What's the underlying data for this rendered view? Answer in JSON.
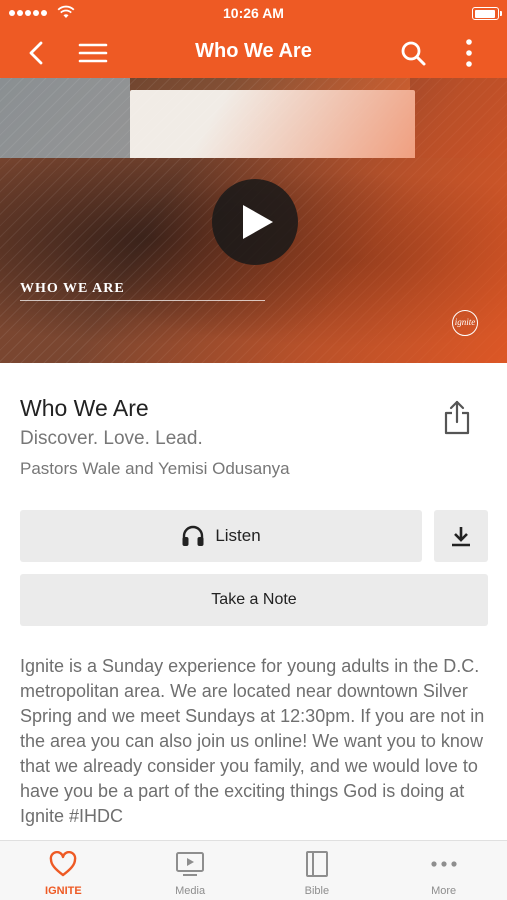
{
  "status_bar": {
    "time": "10:26 AM",
    "signal_bars": 5,
    "battery_level": 0.95
  },
  "nav": {
    "title": "Who We Are",
    "icons": [
      "back-icon",
      "menu-icon",
      "search-icon",
      "more-vertical-icon"
    ]
  },
  "hero": {
    "label": "WHO WE ARE",
    "logo_text": "ignite",
    "play_icon": "play-icon"
  },
  "sermon": {
    "title": "Who We Are",
    "subtitle": "Discover. Love. Lead.",
    "speaker": "Pastors Wale and Yemisi Odusanya"
  },
  "actions": {
    "listen_label": "Listen",
    "take_note_label": "Take a Note"
  },
  "description": "Ignite is a Sunday experience for young adults in the D.C. metropolitan area. We are located near downtown Silver Spring and we meet Sundays at 12:30pm.  If you are not in the area you can also join us online! We want you to know that we already consider you family, and we would love to have you be a part of the exciting things God is doing at Ignite #IHDC",
  "tab_bar": {
    "items": [
      {
        "label": "IGNITE",
        "icon": "heart-icon",
        "active": true
      },
      {
        "label": "Media",
        "icon": "media-icon",
        "active": false
      },
      {
        "label": "Bible",
        "icon": "bible-icon",
        "active": false
      },
      {
        "label": "More",
        "icon": "more-horizontal-icon",
        "active": false
      }
    ]
  },
  "colors": {
    "accent": "#ee5a24",
    "button_bg": "#ebebeb",
    "text_primary": "#222222",
    "text_secondary": "#777777"
  }
}
